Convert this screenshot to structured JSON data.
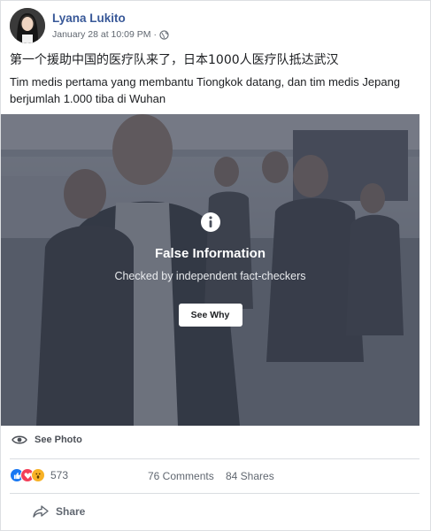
{
  "post": {
    "author": "Lyana Lukito",
    "date": "January 28 at 10:09 PM",
    "separator": "·",
    "text_zh": "第一个援助中国的医疗队来了，日本1000人医疗队抵达武汉",
    "text_id": "Tim medis pertama yang membantu Tiongkok datang, dan tim medis Jepang berjumlah 1.000 tiba di Wuhan"
  },
  "fact_check": {
    "title": "False Information",
    "subtitle": "Checked by independent fact-checkers",
    "button": "See Why"
  },
  "see_photo": "See Photo",
  "engagement": {
    "reaction_count": "573",
    "comments": "76 Comments",
    "shares": "84 Shares"
  },
  "actions": {
    "share": "Share"
  },
  "colors": {
    "link_blue": "#385898",
    "like_blue": "#1877f2",
    "love_red": "#f33e58",
    "haha_yellow": "#f7b125",
    "overlay": "#373e4e"
  },
  "icons": [
    "globe-icon",
    "info-icon",
    "eye-icon",
    "like-reaction-icon",
    "love-reaction-icon",
    "wow-reaction-icon",
    "share-icon"
  ]
}
